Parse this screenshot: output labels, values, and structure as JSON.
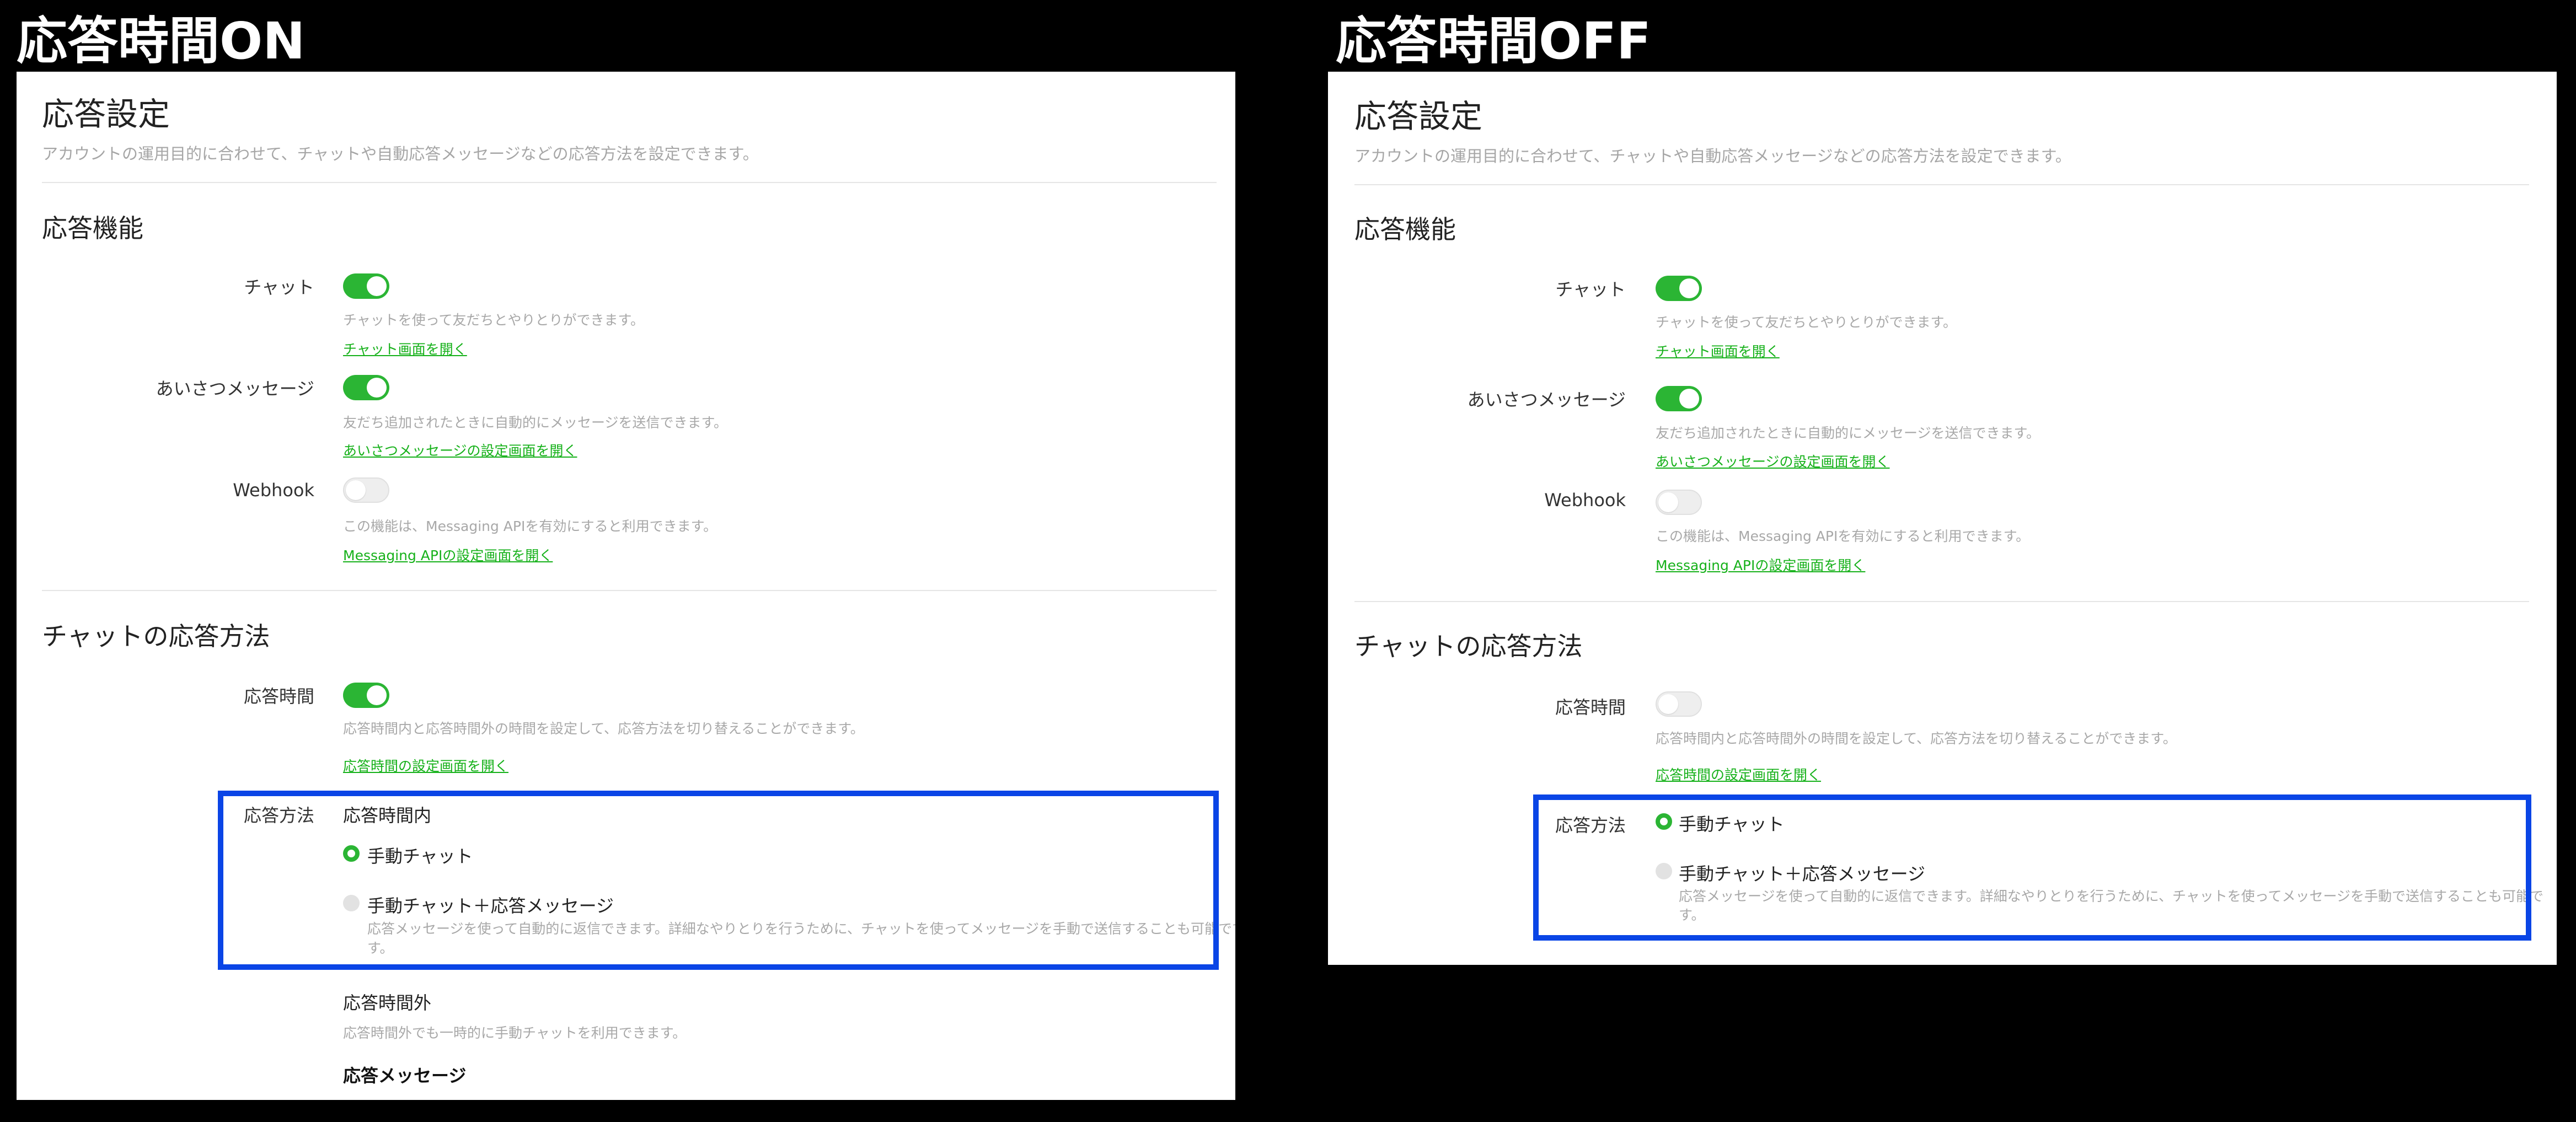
{
  "left": {
    "banner": "応答時間ON",
    "title": "応答設定",
    "subtitle": "アカウントの運用目的に合わせて、チャットや自動応答メッセージなどの応答方法を設定できます。",
    "features_heading": "応答機能",
    "chat": {
      "label": "チャット",
      "toggle": "on",
      "desc": "チャットを使って友だちとやりとりができます。",
      "link": "チャット画面を開く"
    },
    "greeting": {
      "label": "あいさつメッセージ",
      "toggle": "on",
      "desc": "友だち追加されたときに自動的にメッセージを送信できます。",
      "link": "あいさつメッセージの設定画面を開く"
    },
    "webhook": {
      "label": "Webhook",
      "toggle": "off",
      "desc": "この機能は、Messaging APIを有効にすると利用できます。",
      "link": "Messaging APIの設定画面を開く"
    },
    "chat_method_heading": "チャットの応答方法",
    "response_time": {
      "label": "応答時間",
      "toggle": "on",
      "desc": "応答時間内と応答時間外の時間を設定して、応答方法を切り替えることができます。",
      "link": "応答時間の設定画面を開く"
    },
    "method_label": "応答方法",
    "within_hours": "応答時間内",
    "option_manual": "手動チャット",
    "option_manual_auto": "手動チャット＋応答メッセージ",
    "option_manual_auto_desc_1": "応答メッセージを使って自動的に返信できます。詳細なやりとりを行うために、チャットを使ってメッセージを手動で送信することも可能です",
    "option_manual_auto_desc_2": "す。",
    "outside_hours": "応答時間外",
    "outside_hours_desc": "応答時間外でも一時的に手動チャットを利用できます。",
    "response_message": "応答メッセージ"
  },
  "right": {
    "banner": "応答時間OFF",
    "title": "応答設定",
    "subtitle": "アカウントの運用目的に合わせて、チャットや自動応答メッセージなどの応答方法を設定できます。",
    "features_heading": "応答機能",
    "chat": {
      "label": "チャット",
      "toggle": "on",
      "desc": "チャットを使って友だちとやりとりができます。",
      "link": "チャット画面を開く"
    },
    "greeting": {
      "label": "あいさつメッセージ",
      "toggle": "on",
      "desc": "友だち追加されたときに自動的にメッセージを送信できます。",
      "link": "あいさつメッセージの設定画面を開く"
    },
    "webhook": {
      "label": "Webhook",
      "toggle": "off",
      "desc": "この機能は、Messaging APIを有効にすると利用できます。",
      "link": "Messaging APIの設定画面を開く"
    },
    "chat_method_heading": "チャットの応答方法",
    "response_time": {
      "label": "応答時間",
      "toggle": "off",
      "desc": "応答時間内と応答時間外の時間を設定して、応答方法を切り替えることができます。",
      "link": "応答時間の設定画面を開く"
    },
    "method_label": "応答方法",
    "option_manual": "手動チャット",
    "option_manual_auto": "手動チャット＋応答メッセージ",
    "option_manual_auto_desc_1": "応答メッセージを使って自動的に返信できます。詳細なやりとりを行うために、チャットを使ってメッセージを手動で送信することも可能で",
    "option_manual_auto_desc_2": "す。"
  },
  "colors": {
    "accent_green": "#2bb534",
    "link_green": "#16b11a",
    "highlight_blue": "#0a45e6",
    "background": "#000000"
  }
}
